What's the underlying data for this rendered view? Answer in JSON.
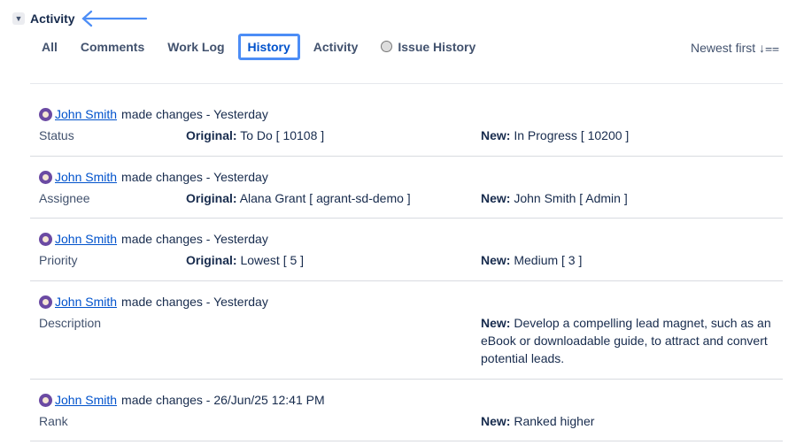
{
  "header": {
    "title": "Activity"
  },
  "tabs": [
    {
      "label": "All"
    },
    {
      "label": "Comments"
    },
    {
      "label": "Work Log"
    },
    {
      "label": "History"
    },
    {
      "label": "Activity"
    },
    {
      "label": "Issue History"
    }
  ],
  "sort": {
    "label": "Newest first ↓⩵"
  },
  "labels": {
    "original": "Original:",
    "new": "New:"
  },
  "entries": [
    {
      "user": "John Smith",
      "action": "made changes - Yesterday",
      "field": "Status",
      "original": "To Do [ 10108 ]",
      "new": "In Progress [ 10200 ]"
    },
    {
      "user": "John Smith",
      "action": "made changes - Yesterday",
      "field": "Assignee",
      "original": "Alana Grant [ agrant-sd-demo ]",
      "new": "John Smith [ Admin ]"
    },
    {
      "user": "John Smith",
      "action": "made changes - Yesterday",
      "field": "Priority",
      "original": "Lowest [ 5 ]",
      "new": "Medium [ 3 ]"
    },
    {
      "user": "John Smith",
      "action": "made changes - Yesterday",
      "field": "Description",
      "new": "Develop a compelling lead magnet, such as an eBook or downloadable guide, to attract and convert potential leads."
    },
    {
      "user": "John Smith",
      "action": "made changes - 26/Jun/25 12:41 PM",
      "field": "Rank",
      "new": "Ranked higher"
    }
  ]
}
